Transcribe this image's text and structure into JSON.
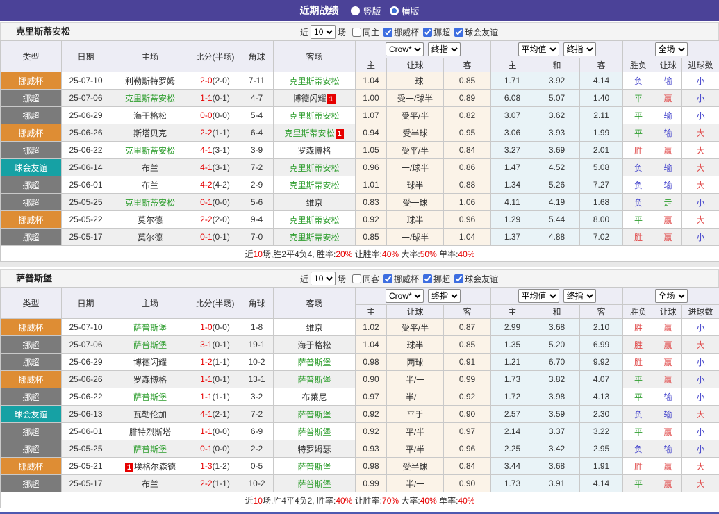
{
  "topbar": {
    "title": "近期战绩",
    "radios": [
      {
        "label": "竖版",
        "selected": false
      },
      {
        "label": "横版",
        "selected": true
      }
    ]
  },
  "controls": {
    "near": "近",
    "count": "10",
    "games": "场"
  },
  "table_header": {
    "main_cols": [
      "类型",
      "日期",
      "主场",
      "比分(半场)",
      "角球",
      "客场"
    ],
    "odds_group": {
      "provider_select": "Crow*",
      "time_select": "终指",
      "subs": [
        "主",
        "让球",
        "客"
      ]
    },
    "avg_group": {
      "provider_select": "平均值",
      "time_select": "终指",
      "subs": [
        "主",
        "和",
        "客"
      ]
    },
    "result_group": {
      "scope_select": "全场",
      "subs": [
        "胜负",
        "让球",
        "进球数"
      ]
    }
  },
  "type_styles": {
    "挪威杯": "cup",
    "挪超": "league",
    "球会友谊": "friendly"
  },
  "result_colors": {
    "胜": "cred",
    "平": "cgreen",
    "负": "cblue",
    "赢": "cred",
    "输": "cblue",
    "走": "cgreen",
    "大": "cred",
    "小": "cblue"
  },
  "colors": {
    "topbar_bg": "#4B4298",
    "cup_bg": "#DE8D34",
    "league_bg": "#7B7B7B",
    "friendly_bg": "#16A1A4",
    "team_green": "#2F9E2F",
    "score_red": "#E60000",
    "odds_col_bg": "#FBF3E8",
    "avg_col_bg": "#E9F3F7",
    "row_alt_bg": "#EFEFEF",
    "header_bg": "#EDEDF5"
  },
  "sections": [
    {
      "team": "克里斯蒂安松",
      "same_label": "同主",
      "same_checked": false,
      "leagues": [
        {
          "label": "挪威杯",
          "checked": true
        },
        {
          "label": "挪超",
          "checked": true
        },
        {
          "label": "球会友谊",
          "checked": true
        }
      ],
      "rows": [
        {
          "type": "挪威杯",
          "date": "25-07-10",
          "home": {
            "name": "利勒斯特罗姆"
          },
          "away": {
            "name": "克里斯蒂安松",
            "green": true
          },
          "score": "2-0",
          "half": "(2-0)",
          "corner": "7-11",
          "odds": [
            "1.04",
            "一球",
            "0.85"
          ],
          "avg": [
            "1.71",
            "3.92",
            "4.14"
          ],
          "results": [
            "负",
            "输",
            "小"
          ]
        },
        {
          "type": "挪超",
          "date": "25-07-06",
          "home": {
            "name": "克里斯蒂安松",
            "green": true
          },
          "away": {
            "name": "博德闪耀",
            "badge_post": "1"
          },
          "score": "1-1",
          "half": "(0-1)",
          "corner": "4-7",
          "odds": [
            "1.00",
            "受一/球半",
            "0.89"
          ],
          "avg": [
            "6.08",
            "5.07",
            "1.40"
          ],
          "results": [
            "平",
            "赢",
            "小"
          ]
        },
        {
          "type": "挪超",
          "date": "25-06-29",
          "home": {
            "name": "海于格松"
          },
          "away": {
            "name": "克里斯蒂安松",
            "green": true
          },
          "score": "0-0",
          "half": "(0-0)",
          "corner": "5-4",
          "odds": [
            "1.07",
            "受平/半",
            "0.82"
          ],
          "avg": [
            "3.07",
            "3.62",
            "2.11"
          ],
          "results": [
            "平",
            "输",
            "小"
          ]
        },
        {
          "type": "挪威杯",
          "date": "25-06-26",
          "home": {
            "name": "斯塔贝克"
          },
          "away": {
            "name": "克里斯蒂安松",
            "green": true,
            "badge_post": "1"
          },
          "score": "2-2",
          "half": "(1-1)",
          "corner": "6-4",
          "odds": [
            "0.94",
            "受半球",
            "0.95"
          ],
          "avg": [
            "3.06",
            "3.93",
            "1.99"
          ],
          "results": [
            "平",
            "输",
            "大"
          ]
        },
        {
          "type": "挪超",
          "date": "25-06-22",
          "home": {
            "name": "克里斯蒂安松",
            "green": true
          },
          "away": {
            "name": "罗森博格"
          },
          "score": "4-1",
          "half": "(3-1)",
          "corner": "3-9",
          "odds": [
            "1.05",
            "受平/半",
            "0.84"
          ],
          "avg": [
            "3.27",
            "3.69",
            "2.01"
          ],
          "results": [
            "胜",
            "赢",
            "大"
          ]
        },
        {
          "type": "球会友谊",
          "date": "25-06-14",
          "home": {
            "name": "布兰"
          },
          "away": {
            "name": "克里斯蒂安松",
            "green": true
          },
          "score": "4-1",
          "half": "(3-1)",
          "corner": "7-2",
          "odds": [
            "0.96",
            "一/球半",
            "0.86"
          ],
          "avg": [
            "1.47",
            "4.52",
            "5.08"
          ],
          "results": [
            "负",
            "输",
            "大"
          ]
        },
        {
          "type": "挪超",
          "date": "25-06-01",
          "home": {
            "name": "布兰"
          },
          "away": {
            "name": "克里斯蒂安松",
            "green": true
          },
          "score": "4-2",
          "half": "(4-2)",
          "corner": "2-9",
          "odds": [
            "1.01",
            "球半",
            "0.88"
          ],
          "avg": [
            "1.34",
            "5.26",
            "7.27"
          ],
          "results": [
            "负",
            "输",
            "大"
          ]
        },
        {
          "type": "挪超",
          "date": "25-05-25",
          "home": {
            "name": "克里斯蒂安松",
            "green": true
          },
          "away": {
            "name": "维京"
          },
          "score": "0-1",
          "half": "(0-0)",
          "corner": "5-6",
          "odds": [
            "0.83",
            "受一球",
            "1.06"
          ],
          "avg": [
            "4.11",
            "4.19",
            "1.68"
          ],
          "results": [
            "负",
            "走",
            "小"
          ]
        },
        {
          "type": "挪威杯",
          "date": "25-05-22",
          "home": {
            "name": "莫尔德"
          },
          "away": {
            "name": "克里斯蒂安松",
            "green": true
          },
          "score": "2-2",
          "half": "(2-0)",
          "corner": "9-4",
          "odds": [
            "0.92",
            "球半",
            "0.96"
          ],
          "avg": [
            "1.29",
            "5.44",
            "8.00"
          ],
          "results": [
            "平",
            "赢",
            "大"
          ]
        },
        {
          "type": "挪超",
          "date": "25-05-17",
          "home": {
            "name": "莫尔德"
          },
          "away": {
            "name": "克里斯蒂安松",
            "green": true
          },
          "score": "0-1",
          "half": "(0-1)",
          "corner": "7-0",
          "odds": [
            "0.85",
            "一/球半",
            "1.04"
          ],
          "avg": [
            "1.37",
            "4.88",
            "7.02"
          ],
          "results": [
            "胜",
            "赢",
            "小"
          ]
        }
      ],
      "summary": [
        {
          "t": "近"
        },
        {
          "t": "10",
          "red": true
        },
        {
          "t": "场,胜2平4负4, 胜率:"
        },
        {
          "t": "20%",
          "red": true
        },
        {
          "t": " 让胜率:"
        },
        {
          "t": "40%",
          "red": true
        },
        {
          "t": " 大率:"
        },
        {
          "t": "50%",
          "red": true
        },
        {
          "t": " 单率:"
        },
        {
          "t": "40%",
          "red": true
        }
      ]
    },
    {
      "team": "萨普斯堡",
      "same_label": "同客",
      "same_checked": false,
      "leagues": [
        {
          "label": "挪威杯",
          "checked": true
        },
        {
          "label": "挪超",
          "checked": true
        },
        {
          "label": "球会友谊",
          "checked": true
        }
      ],
      "rows": [
        {
          "type": "挪威杯",
          "date": "25-07-10",
          "home": {
            "name": "萨普斯堡",
            "green": true
          },
          "away": {
            "name": "维京"
          },
          "score": "1-0",
          "half": "(0-0)",
          "corner": "1-8",
          "odds": [
            "1.02",
            "受平/半",
            "0.87"
          ],
          "avg": [
            "2.99",
            "3.68",
            "2.10"
          ],
          "results": [
            "胜",
            "赢",
            "小"
          ]
        },
        {
          "type": "挪超",
          "date": "25-07-06",
          "home": {
            "name": "萨普斯堡",
            "green": true
          },
          "away": {
            "name": "海于格松"
          },
          "score": "3-1",
          "half": "(0-1)",
          "corner": "19-1",
          "odds": [
            "1.04",
            "球半",
            "0.85"
          ],
          "avg": [
            "1.35",
            "5.20",
            "6.99"
          ],
          "results": [
            "胜",
            "赢",
            "大"
          ]
        },
        {
          "type": "挪超",
          "date": "25-06-29",
          "home": {
            "name": "博德闪耀"
          },
          "away": {
            "name": "萨普斯堡",
            "green": true
          },
          "score": "1-2",
          "half": "(1-1)",
          "corner": "10-2",
          "odds": [
            "0.98",
            "两球",
            "0.91"
          ],
          "avg": [
            "1.21",
            "6.70",
            "9.92"
          ],
          "results": [
            "胜",
            "赢",
            "小"
          ]
        },
        {
          "type": "挪威杯",
          "date": "25-06-26",
          "home": {
            "name": "罗森博格"
          },
          "away": {
            "name": "萨普斯堡",
            "green": true
          },
          "score": "1-1",
          "half": "(0-1)",
          "corner": "13-1",
          "odds": [
            "0.90",
            "半/一",
            "0.99"
          ],
          "avg": [
            "1.73",
            "3.82",
            "4.07"
          ],
          "results": [
            "平",
            "赢",
            "小"
          ]
        },
        {
          "type": "挪超",
          "date": "25-06-22",
          "home": {
            "name": "萨普斯堡",
            "green": true
          },
          "away": {
            "name": "布莱尼"
          },
          "score": "1-1",
          "half": "(1-1)",
          "corner": "3-2",
          "odds": [
            "0.97",
            "半/一",
            "0.92"
          ],
          "avg": [
            "1.72",
            "3.98",
            "4.13"
          ],
          "results": [
            "平",
            "输",
            "小"
          ]
        },
        {
          "type": "球会友谊",
          "date": "25-06-13",
          "home": {
            "name": "瓦勒伦加"
          },
          "away": {
            "name": "萨普斯堡",
            "green": true
          },
          "score": "4-1",
          "half": "(2-1)",
          "corner": "7-2",
          "odds": [
            "0.92",
            "平手",
            "0.90"
          ],
          "avg": [
            "2.57",
            "3.59",
            "2.30"
          ],
          "results": [
            "负",
            "输",
            "大"
          ]
        },
        {
          "type": "挪超",
          "date": "25-06-01",
          "home": {
            "name": "腓特烈斯塔"
          },
          "away": {
            "name": "萨普斯堡",
            "green": true
          },
          "score": "1-1",
          "half": "(0-0)",
          "corner": "6-9",
          "odds": [
            "0.92",
            "平/半",
            "0.97"
          ],
          "avg": [
            "2.14",
            "3.37",
            "3.22"
          ],
          "results": [
            "平",
            "赢",
            "小"
          ]
        },
        {
          "type": "挪超",
          "date": "25-05-25",
          "home": {
            "name": "萨普斯堡",
            "green": true
          },
          "away": {
            "name": "特罗姆瑟"
          },
          "score": "0-1",
          "half": "(0-0)",
          "corner": "2-2",
          "odds": [
            "0.93",
            "平/半",
            "0.96"
          ],
          "avg": [
            "2.25",
            "3.42",
            "2.95"
          ],
          "results": [
            "负",
            "输",
            "小"
          ]
        },
        {
          "type": "挪威杯",
          "date": "25-05-21",
          "home": {
            "name": "埃格尔森德",
            "badge_pre": "1"
          },
          "away": {
            "name": "萨普斯堡",
            "green": true
          },
          "score": "1-3",
          "half": "(1-2)",
          "corner": "0-5",
          "odds": [
            "0.98",
            "受半球",
            "0.84"
          ],
          "avg": [
            "3.44",
            "3.68",
            "1.91"
          ],
          "results": [
            "胜",
            "赢",
            "大"
          ]
        },
        {
          "type": "挪超",
          "date": "25-05-17",
          "home": {
            "name": "布兰"
          },
          "away": {
            "name": "萨普斯堡",
            "green": true
          },
          "score": "2-2",
          "half": "(1-1)",
          "corner": "10-2",
          "odds": [
            "0.99",
            "半/一",
            "0.90"
          ],
          "avg": [
            "1.73",
            "3.91",
            "4.14"
          ],
          "results": [
            "平",
            "赢",
            "大"
          ]
        }
      ],
      "summary": [
        {
          "t": "近"
        },
        {
          "t": "10",
          "red": true
        },
        {
          "t": "场,胜4平4负2, 胜率:"
        },
        {
          "t": "40%",
          "red": true
        },
        {
          "t": " 让胜率:"
        },
        {
          "t": "70%",
          "red": true
        },
        {
          "t": " 大率:"
        },
        {
          "t": "40%",
          "red": true
        },
        {
          "t": " 单率:"
        },
        {
          "t": "40%",
          "red": true
        }
      ]
    }
  ]
}
